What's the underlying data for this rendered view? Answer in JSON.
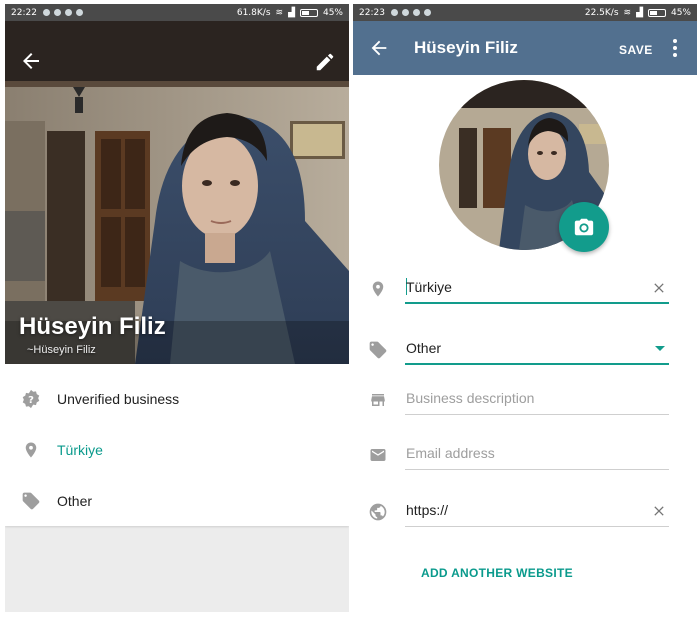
{
  "left_screen": {
    "status_bar": {
      "time": "22:22",
      "speed": "61.8K/s",
      "battery": "45%"
    },
    "header": {
      "name": "Hüseyin Filiz",
      "subtitle": "~Hüseyin Filiz"
    },
    "info_rows": [
      {
        "icon": "question-badge-icon",
        "text": "Unverified business"
      },
      {
        "icon": "location-pin-icon",
        "text": "Türkiye"
      },
      {
        "icon": "tag-icon",
        "text": "Other"
      }
    ]
  },
  "right_screen": {
    "status_bar": {
      "time": "22:23",
      "speed": "22.5K/s",
      "battery": "45%"
    },
    "toolbar": {
      "title": "Hüseyin Filiz",
      "save_label": "SAVE"
    },
    "fields": {
      "location": {
        "value": "Türkiye"
      },
      "category": {
        "value": "Other"
      },
      "description": {
        "placeholder": "Business description"
      },
      "email": {
        "placeholder": "Email address"
      },
      "website": {
        "value": "https://"
      }
    },
    "add_website_label": "ADD ANOTHER WEBSITE"
  },
  "colors": {
    "accent": "#129c8c",
    "toolbar": "#52708f",
    "status_bar": "#4a4a4a"
  }
}
